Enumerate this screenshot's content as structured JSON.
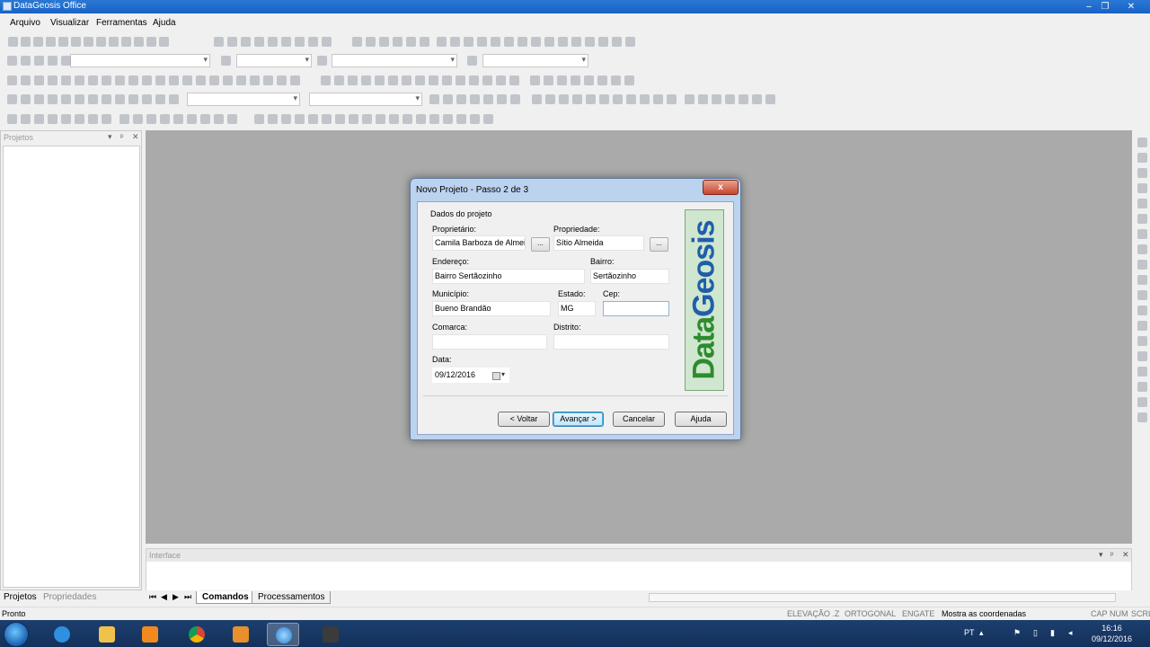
{
  "window": {
    "title": "DataGeosis Office"
  },
  "menu": {
    "items": [
      "Arquivo",
      "Visualizar",
      "Ferramentas",
      "Ajuda"
    ]
  },
  "left_panel": {
    "title": "Projetos",
    "tabs": [
      "Projetos",
      "Propriedades"
    ]
  },
  "interface_panel": {
    "title": "Interface"
  },
  "bottom_tabs": {
    "items": [
      "Comandos",
      "Processamentos"
    ]
  },
  "status": {
    "left": "Pronto",
    "segments": [
      "ELEVAÇÃO .Z",
      "ORTOGONAL",
      "ENGATE",
      "Mostra as coordenadas",
      "CAP",
      "NUM",
      "SCRL"
    ]
  },
  "taskbar": {
    "language": "PT",
    "time": "16:16",
    "date": "09/12/2016"
  },
  "dialog": {
    "title": "Novo Projeto - Passo 2 de 3",
    "close_label": "x",
    "section_title": "Dados do projeto",
    "fields": {
      "proprietario": {
        "label": "Proprietário:",
        "value": "Camila Barboza de Almeida"
      },
      "propriedade": {
        "label": "Propriedade:",
        "value": "Sítio Almeida"
      },
      "endereco": {
        "label": "Endereço:",
        "value": "Bairro Sertãozinho"
      },
      "bairro": {
        "label": "Bairro:",
        "value": "Sertãozinho"
      },
      "municipio": {
        "label": "Município:",
        "value": "Bueno Brandão"
      },
      "estado": {
        "label": "Estado:",
        "value": "MG"
      },
      "cep": {
        "label": "Cep:",
        "value": ""
      },
      "comarca": {
        "label": "Comarca:",
        "value": ""
      },
      "distrito": {
        "label": "Distrito:",
        "value": ""
      },
      "data": {
        "label": "Data:",
        "value": "09/12/2016"
      }
    },
    "dots_label": "...",
    "buttons": {
      "back": "< Voltar",
      "next": "Avançar >",
      "cancel": "Cancelar",
      "help": "Ajuda"
    },
    "logo": {
      "part1": "Data",
      "part2": "Geosis"
    }
  }
}
